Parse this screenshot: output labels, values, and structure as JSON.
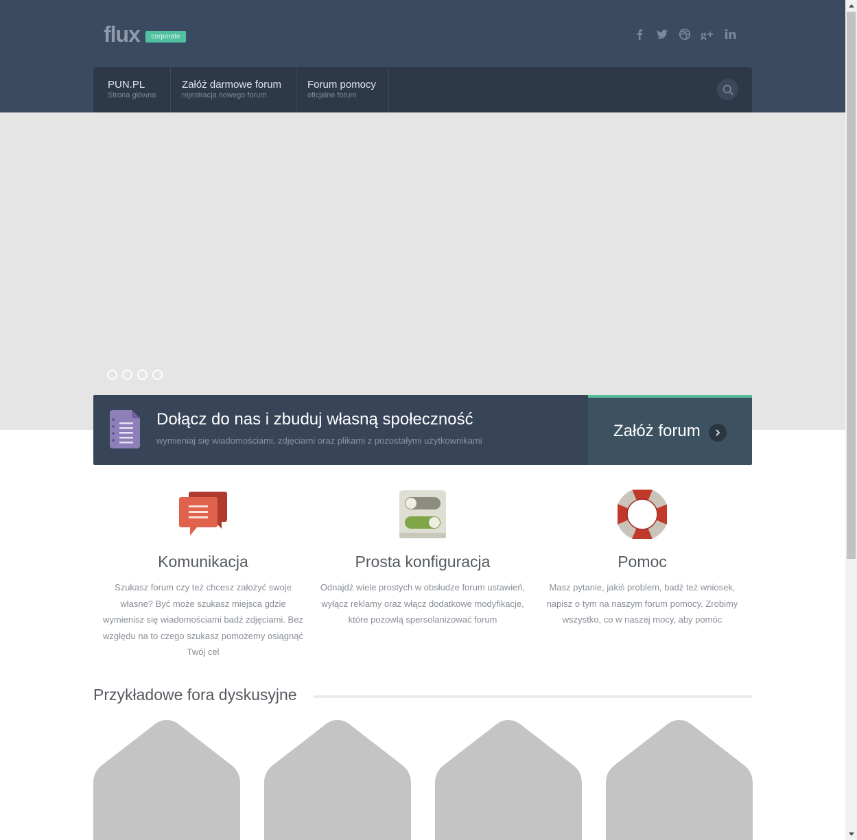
{
  "header": {
    "logo": "flux",
    "logo_badge": "corporate",
    "social_icons": [
      "facebook-icon",
      "twitter-icon",
      "dribbble-icon",
      "google-plus-icon",
      "linkedin-icon"
    ]
  },
  "nav": {
    "items": [
      {
        "title": "PUN.PL",
        "subtitle": "Strona główna"
      },
      {
        "title": "Załóż darmowe forum",
        "subtitle": "rejestracja nowego forum"
      },
      {
        "title": "Forum pomocy",
        "subtitle": "oficjalne forum"
      }
    ],
    "search_icon": "search-icon"
  },
  "slider": {
    "dot_count": 4
  },
  "cta": {
    "title": "Dołącz do nas i zbuduj własną społeczność",
    "subtitle": "wymieniaj się wiadomościami, zdjęciami oraz plikami z pozostałymi użytkownikami",
    "button_label": "Załóż forum"
  },
  "features": [
    {
      "title": "Komunikacja",
      "text": "Szukasz forum czy też chcesz założyć swoje własne? Być może szukasz miejsca gdzie wymienisz się wiadomościami badź zdjęciami. Bez względu na to czego szukasz pomożemy osiągnąć Twój cel"
    },
    {
      "title": "Prosta konfiguracja",
      "text": "Odnajdź wiele prostych w obsłudze forum ustawień, wyłącz reklamy oraz włącz dodatkowe modyfikacje, które pozowlą spersolanizować forum"
    },
    {
      "title": "Pomoc",
      "text": "Masz pytanie, jakiś problem, badź też wniosek, napisz o tym na naszym forum pomocy. Zrobimy wszystko, co w naszej mocy, aby pomóc"
    }
  ],
  "examples": {
    "title": "Przykładowe fora dyskusyjne",
    "count": 4
  },
  "colors": {
    "header_bg": "#3a4a61",
    "nav_bg": "#2d3849",
    "hero_bg": "#e4e5e4",
    "accent": "#55bb98",
    "cta_bg": "#384559",
    "placeholder": "#c4c4c4"
  }
}
